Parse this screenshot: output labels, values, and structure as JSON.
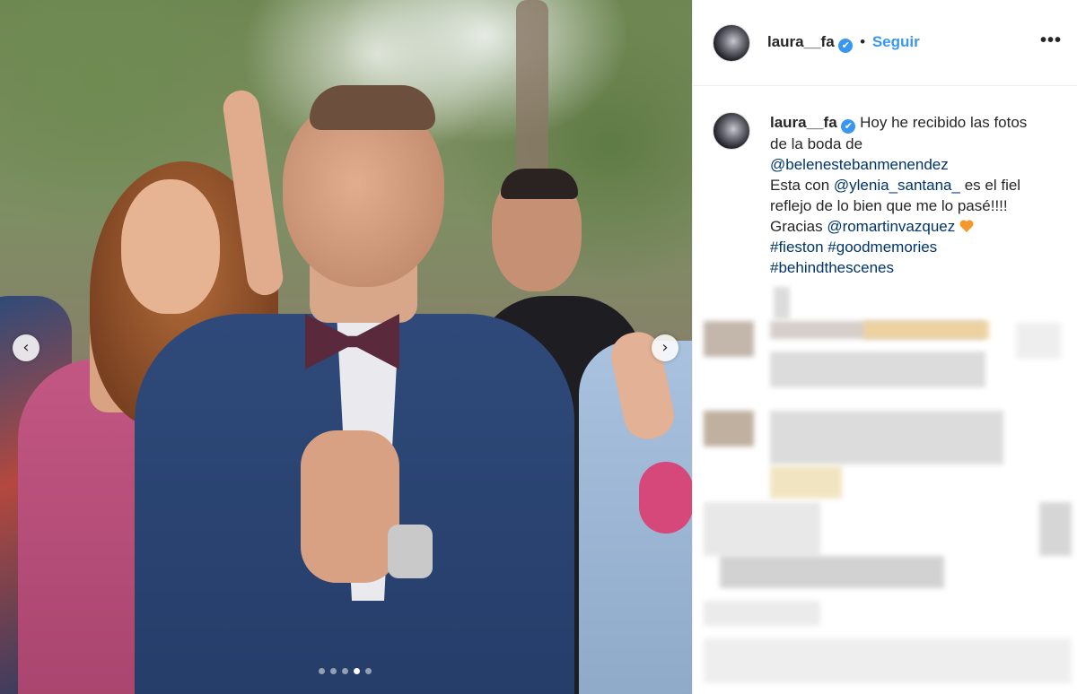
{
  "post": {
    "username": "laura__fa",
    "verified_mark": "✔",
    "separator": "•",
    "follow_label": "Seguir",
    "more_label": "•••"
  },
  "caption": {
    "username": "laura__fa",
    "text1": "Hoy he recibido las fotos",
    "text2": "de la boda de",
    "mention1": "@belenestebanmenendez",
    "text3": "Esta con",
    "mention2": "@ylenia_santana_",
    "text4": "es el fiel",
    "text5": "reflejo de lo bien que me lo pasé!!!!",
    "text6": "Gracias",
    "mention3": "@romartinvazquez",
    "hashtag1": "#fieston",
    "hashtag2": "#goodmemories",
    "hashtag3": "#behindthescenes"
  },
  "carousel": {
    "prev_icon": "‹",
    "next_icon": "›",
    "total_slides": 5,
    "active_slide": 4
  },
  "colors": {
    "accent": "#3897f0",
    "link": "#003569",
    "text": "#262626",
    "heart": "#f5972d"
  }
}
